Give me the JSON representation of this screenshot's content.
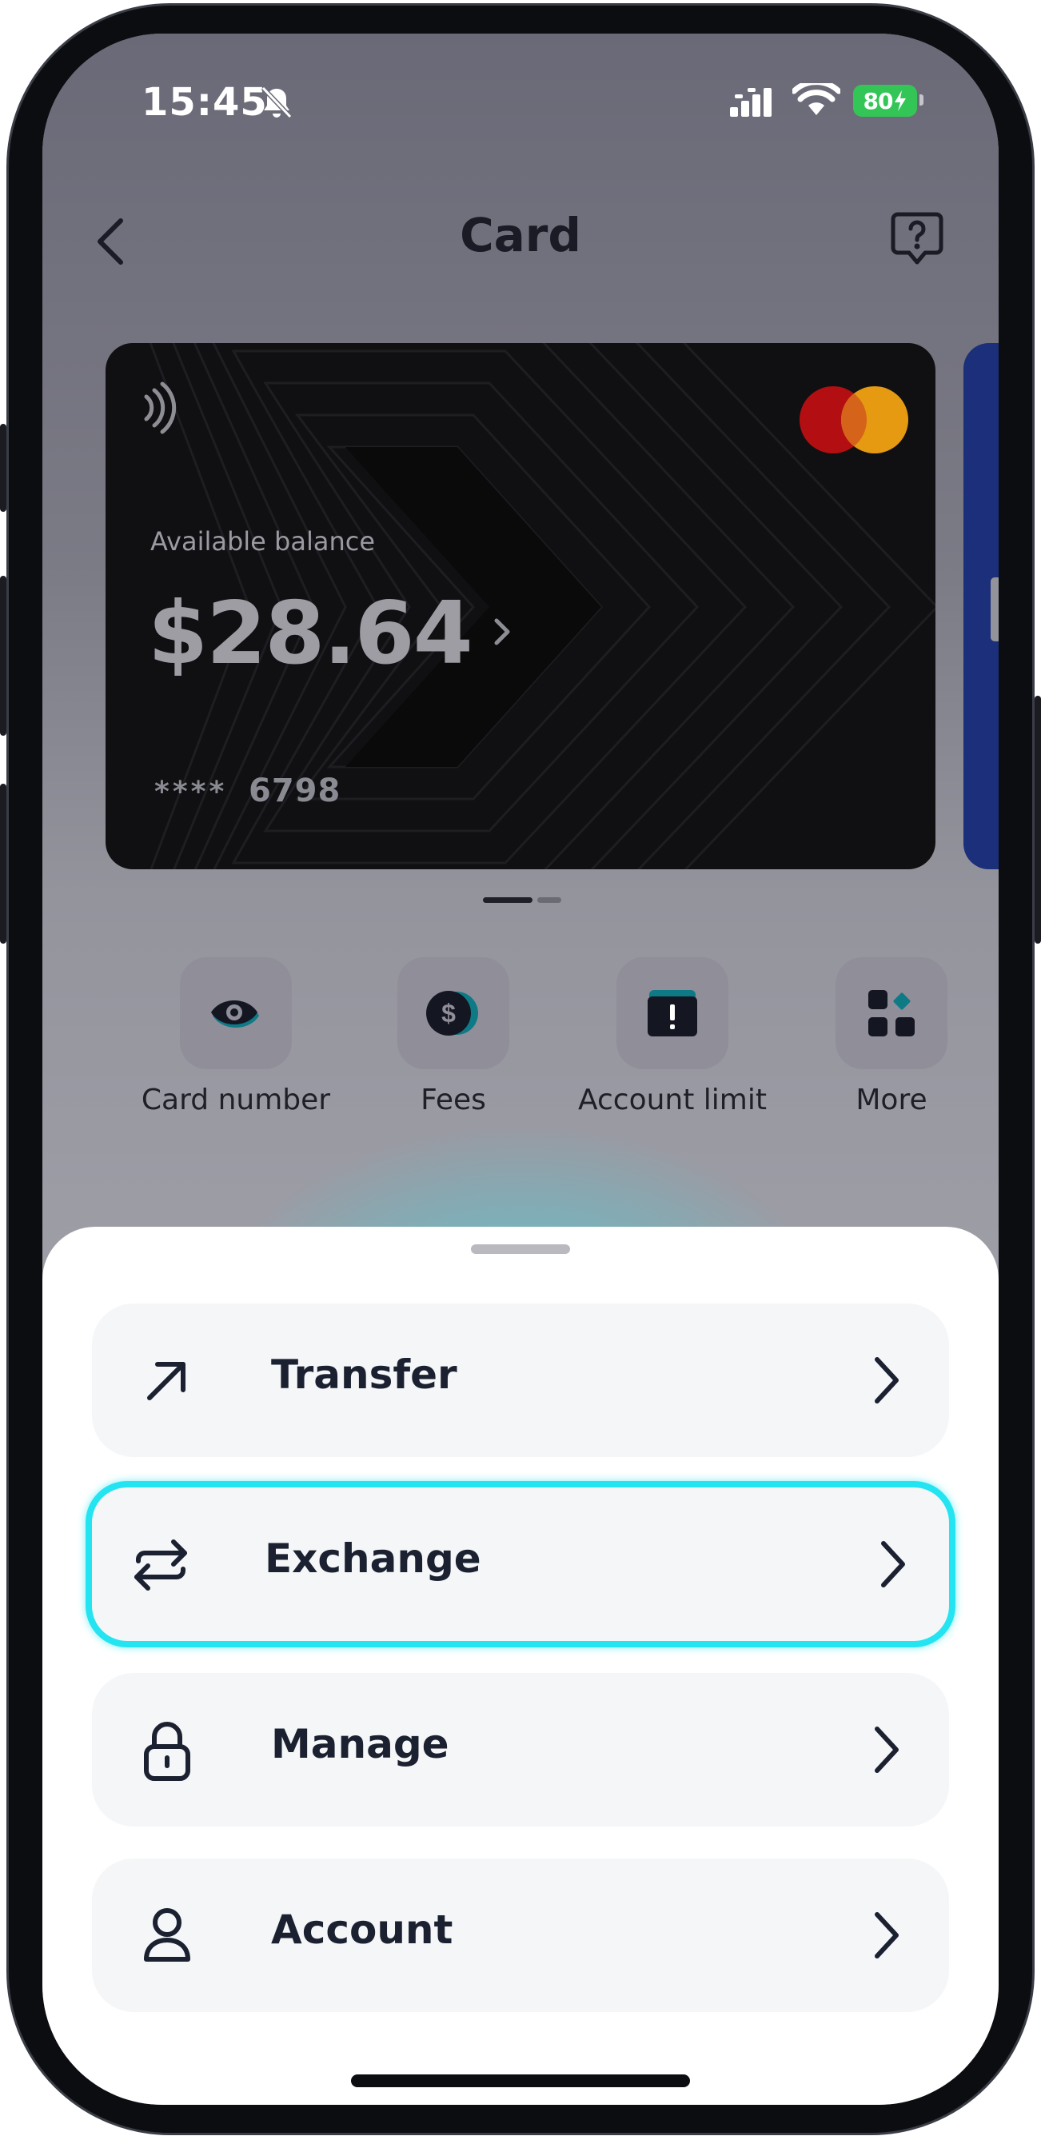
{
  "status_bar": {
    "time": "15:45",
    "battery": "80"
  },
  "header": {
    "title": "Card"
  },
  "card": {
    "balance_label": "Available balance",
    "balance": "$28.64",
    "masked": "****",
    "last_digits": "6798"
  },
  "quick_actions": [
    {
      "label": "Card number",
      "icon": "eye-icon"
    },
    {
      "label": "Fees",
      "icon": "dollar-coin-icon"
    },
    {
      "label": "Account limit",
      "icon": "alert-card-icon"
    },
    {
      "label": "More",
      "icon": "grid-icon"
    }
  ],
  "menu": [
    {
      "label": "Transfer",
      "icon": "arrow-up-right-icon"
    },
    {
      "label": "Exchange",
      "icon": "swap-arrows-icon",
      "highlighted": true
    },
    {
      "label": "Manage",
      "icon": "lock-icon"
    },
    {
      "label": "Account",
      "icon": "user-icon"
    }
  ],
  "colors": {
    "highlight": "#23e4f0",
    "glow": "#55c8d3",
    "battery": "#33c657",
    "mastercard_red": "#b30f12",
    "mastercard_orange": "#e59a12"
  }
}
